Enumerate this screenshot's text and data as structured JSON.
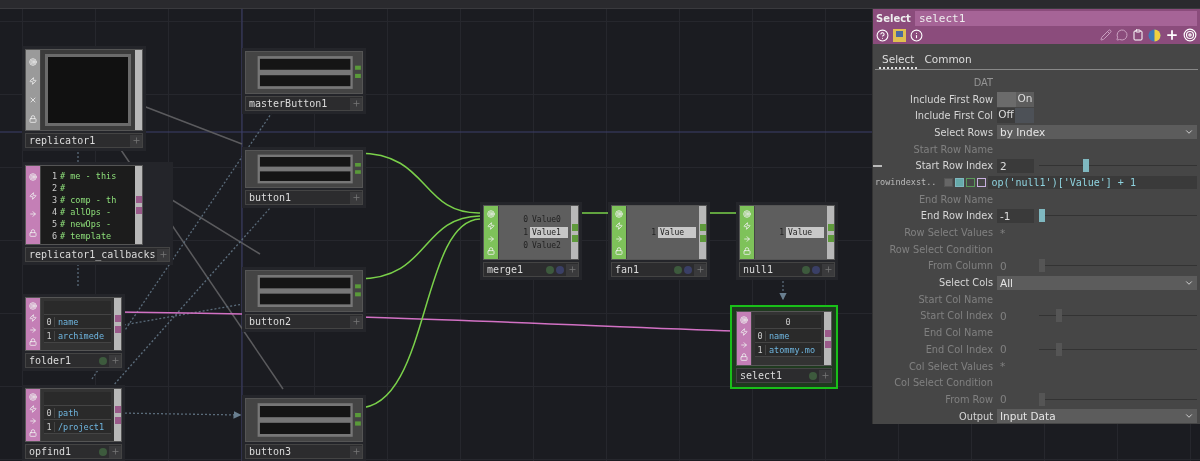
{
  "nodes": [
    {
      "name": "replicator1",
      "kind": "comp",
      "selected": false
    },
    {
      "name": "replicator1_callbacks",
      "kind": "text",
      "selected": false,
      "lines": [
        {
          "number": "1",
          "code": "# me - this"
        },
        {
          "number": "2",
          "code": "#"
        },
        {
          "number": "3",
          "code": "# comp - th"
        },
        {
          "number": "4",
          "code": "# allOps -"
        },
        {
          "number": "5",
          "code": "# newOps -"
        },
        {
          "number": "6",
          "code": "# template"
        }
      ]
    },
    {
      "name": "folder1",
      "kind": "table",
      "selected": false,
      "rows": [
        {
          "index": "0",
          "value": "name"
        },
        {
          "index": "1",
          "value": "archimede"
        }
      ]
    },
    {
      "name": "opfind1",
      "kind": "table",
      "selected": false,
      "rows": [
        {
          "index": "0",
          "value": "path"
        },
        {
          "index": "1",
          "value": "/project1"
        }
      ]
    },
    {
      "name": "masterButton1",
      "kind": "button",
      "selected": false
    },
    {
      "name": "button1",
      "kind": "button",
      "selected": false
    },
    {
      "name": "button2",
      "kind": "button",
      "selected": false
    },
    {
      "name": "button3",
      "kind": "button",
      "selected": false
    },
    {
      "name": "merge1",
      "kind": "chop",
      "selected": false,
      "channels": [
        {
          "value": "0",
          "name": "Value0",
          "active": false
        },
        {
          "value": "1",
          "name": "Value1",
          "active": true
        },
        {
          "value": "0",
          "name": "Value2",
          "active": false
        }
      ]
    },
    {
      "name": "fan1",
      "kind": "chop",
      "selected": false,
      "channels": [
        {
          "value": "1",
          "name": "Value",
          "active": true
        }
      ]
    },
    {
      "name": "null1",
      "kind": "chop",
      "selected": false,
      "channels": [
        {
          "value": "1",
          "name": "Value",
          "active": true
        }
      ]
    },
    {
      "name": "select1",
      "kind": "table",
      "selected": true,
      "header": "0",
      "rows": [
        {
          "index": "0",
          "value": "name"
        },
        {
          "index": "1",
          "value": "atommy.mo"
        }
      ]
    }
  ],
  "panel": {
    "type": "Select",
    "name": "select1",
    "tabs": [
      {
        "label": "Select",
        "selected": true
      },
      {
        "label": "Common",
        "selected": false
      }
    ],
    "params": [
      {
        "kind": "header",
        "label": "DAT"
      },
      {
        "kind": "toggle",
        "label": "Include First Row",
        "value": "On",
        "on": true
      },
      {
        "kind": "toggle",
        "label": "Include First Col",
        "value": "Off",
        "on": false
      },
      {
        "kind": "menu",
        "label": "Select Rows",
        "value": "by Index",
        "disabled": false
      },
      {
        "kind": "text",
        "label": "Start Row Name",
        "disabled": true
      },
      {
        "kind": "slider",
        "label": "Start Row Index",
        "value": "2",
        "level": 0.29,
        "disabled": false,
        "expanded": true
      },
      {
        "kind": "expression",
        "label": "rowindexst..",
        "value": "op('null1')['Value'] + 1"
      },
      {
        "kind": "text",
        "label": "End Row Name",
        "disabled": true
      },
      {
        "kind": "slider",
        "label": "End Row Index",
        "value": "-1",
        "level": 0,
        "disabled": false
      },
      {
        "kind": "text",
        "label": "Row Select Values",
        "value": "*",
        "disabled": true
      },
      {
        "kind": "text",
        "label": "Row Select Condition",
        "disabled": true
      },
      {
        "kind": "slider",
        "label": "From Column",
        "value": "0",
        "level": 0,
        "disabled": true
      },
      {
        "kind": "menu",
        "label": "Select Cols",
        "value": "All",
        "disabled": false
      },
      {
        "kind": "text",
        "label": "Start Col Name",
        "disabled": true
      },
      {
        "kind": "slider",
        "label": "Start Col Index",
        "value": "0",
        "level": 0.11,
        "disabled": true
      },
      {
        "kind": "text",
        "label": "End Col Name",
        "disabled": true
      },
      {
        "kind": "slider",
        "label": "End Col Index",
        "value": "0",
        "level": 0.11,
        "disabled": true
      },
      {
        "kind": "text",
        "label": "Col Select Values",
        "value": "*",
        "disabled": true
      },
      {
        "kind": "text",
        "label": "Col Select Condition",
        "disabled": true
      },
      {
        "kind": "slider",
        "label": "From Row",
        "value": "0",
        "level": 0,
        "disabled": true
      },
      {
        "kind": "menu",
        "label": "Output",
        "value": "Input Data",
        "disabled": false
      }
    ]
  }
}
